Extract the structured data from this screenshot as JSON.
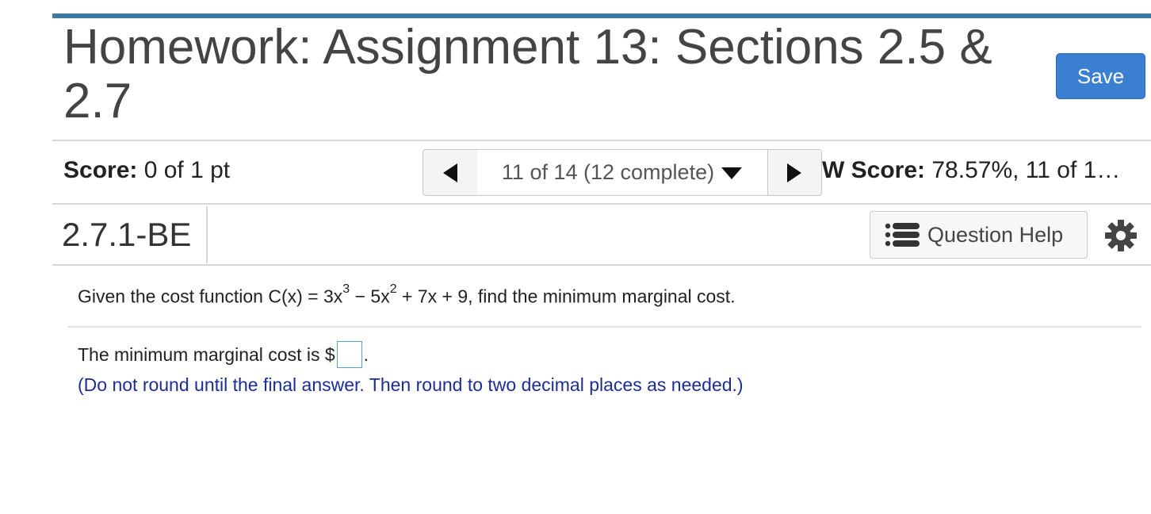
{
  "header": {
    "title": "Homework: Assignment 13: Sections 2.5 & 2.7",
    "save_label": "Save"
  },
  "status": {
    "score_label": "Score:",
    "score_value": " 0 of 1 pt",
    "nav_position": "11 of 14 (12 complete)",
    "hw_score_label": "W Score:",
    "hw_score_value": " 78.57%, 11 of 1…"
  },
  "question": {
    "id": "2.7.1-BE",
    "help_label": "Question Help",
    "prompt_before": "Given the cost function C(x) = 3x",
    "exp1": "3",
    "prompt_mid": " − 5x",
    "exp2": "2",
    "prompt_after": " + 7x + 9, find the minimum marginal cost.",
    "answer_before": "The minimum marginal cost is $",
    "answer_value": "",
    "answer_after": ".",
    "hint": "(Do not round until the final answer. Then round to two decimal places as needed.)"
  },
  "colors": {
    "accent": "#3a7aa4",
    "save_button": "#3a7fd0",
    "hint_text": "#1c2d9a"
  },
  "icons": [
    "prev-arrow-icon",
    "dropdown-caret-icon",
    "next-arrow-icon",
    "list-icon",
    "gear-icon"
  ]
}
